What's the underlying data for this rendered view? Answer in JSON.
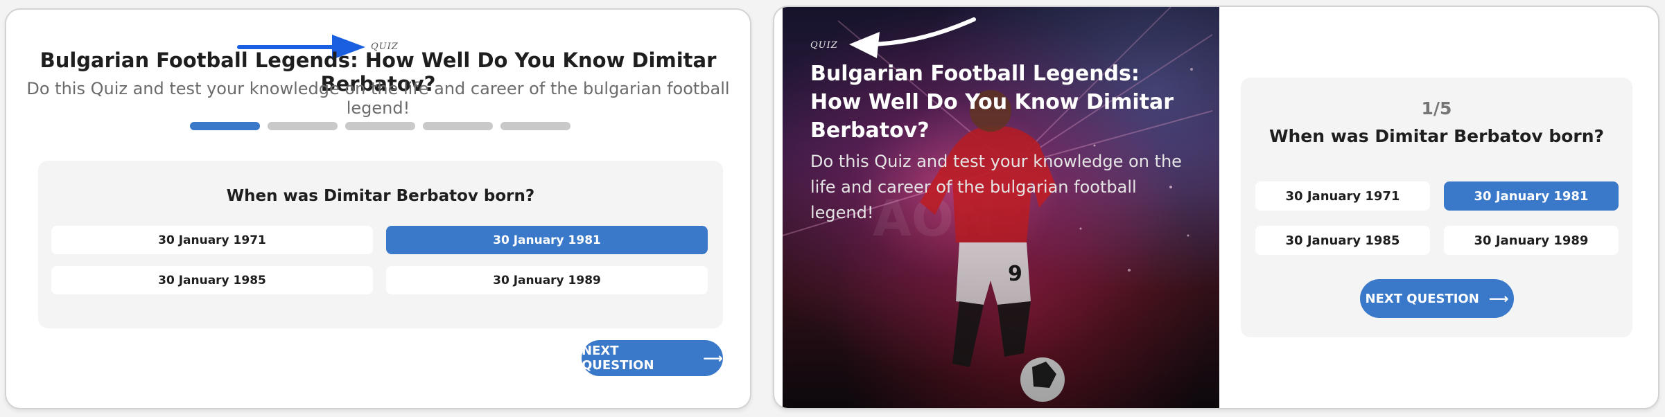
{
  "quiz": {
    "logo_text": "QUIZ",
    "title": "Bulgarian Football Legends: How Well Do You Know Dimitar Berbatov?",
    "description": "Do this Quiz and test your knowledge on the life and career of the bulgarian football legend!",
    "progress": {
      "current": 1,
      "total": 5,
      "counter_text": "1/5"
    },
    "question": "When was Dimitar Berbatov born?",
    "answers": [
      "30 January 1971",
      "30 January 1981",
      "30 January 1985",
      "30 January 1989"
    ],
    "selected_answer": "30 January 1981",
    "next_button_label": "NEXT QUESTION",
    "next_button_icon": "arrow-right-icon"
  },
  "hero_image": {
    "shirt_number": "9"
  },
  "colors": {
    "accent": "#3a78c9",
    "annotation_arrow_blue": "#1a5fe0",
    "annotation_arrow_white": "#ffffff",
    "panel_background": "#f4f4f4",
    "progress_inactive": "#c9c9c9"
  }
}
